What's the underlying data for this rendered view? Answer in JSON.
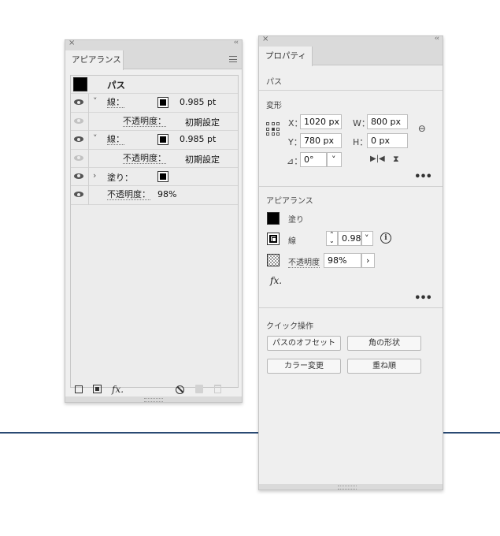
{
  "appearance_panel": {
    "close": "×",
    "collapse": "‹‹",
    "tab": "アピアランス",
    "path_label": "パス",
    "rows": [
      {
        "type": "stroke",
        "label": "線：",
        "value": "0.985 pt"
      },
      {
        "type": "opacity",
        "label": "不透明度：",
        "value": "初期設定"
      },
      {
        "type": "stroke",
        "label": "線：",
        "value": "0.985 pt"
      },
      {
        "type": "opacity",
        "label": "不透明度：",
        "value": "初期設定"
      },
      {
        "type": "fill",
        "label": "塗り："
      },
      {
        "type": "opacity",
        "label": "不透明度：",
        "value": "98%"
      }
    ],
    "chevron_open": "˅",
    "chevron_closed": "›",
    "fx": "fx."
  },
  "properties_panel": {
    "close": "×",
    "collapse": "‹‹",
    "tab": "プロパティ",
    "object_type": "パス",
    "transform": {
      "title": "変形",
      "x_label": "X：",
      "x_value": "1020 px",
      "y_label": "Y：",
      "y_value": "780 px",
      "w_label": "W：",
      "w_value": "800 px",
      "h_label": "H：",
      "h_value": "0 px",
      "angle_icon": "⊿：",
      "angle_value": "0°",
      "dropdown": "˅"
    },
    "appearance": {
      "title": "アピアランス",
      "fill_label": "塗り",
      "stroke_label": "線",
      "stroke_value": "0.98",
      "stroke_unit_dropdown": "˅",
      "info": "i",
      "opacity_label": "不透明度",
      "opacity_value": "98%",
      "opacity_arrow": "›",
      "fx": "fx."
    },
    "more": "•••",
    "quick_actions": {
      "title": "クイック操作",
      "buttons": [
        "パスのオフセット",
        "角の形状",
        "カラー変更",
        "重ね順"
      ]
    }
  }
}
